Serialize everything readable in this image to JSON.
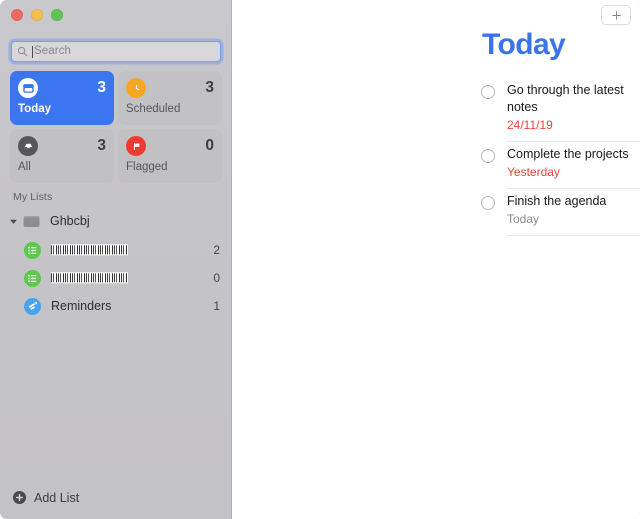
{
  "window": {
    "traffic_lights": [
      {
        "name": "close",
        "color": "#ee6a5e"
      },
      {
        "name": "minimize",
        "color": "#f4bd4f"
      },
      {
        "name": "maximize",
        "color": "#61c454"
      }
    ]
  },
  "sidebar": {
    "search": {
      "placeholder": "Search",
      "value": "",
      "icon": "search-icon"
    },
    "smart_lists": [
      {
        "label": "Today",
        "count": "3",
        "icon": "today-calendar-icon",
        "badge_color": "#ffffff",
        "selected": true
      },
      {
        "label": "Scheduled",
        "count": "3",
        "icon": "clock-icon",
        "badge_color": "#f6a623",
        "selected": false
      },
      {
        "label": "All",
        "count": "3",
        "icon": "inbox-tray-icon",
        "badge_color": "#57575b",
        "selected": false
      },
      {
        "label": "Flagged",
        "count": "0",
        "icon": "flag-icon",
        "badge_color": "#ec3b32",
        "selected": false
      }
    ],
    "section_header": "My Lists",
    "group": {
      "name": "Ghbcbj",
      "expanded": true,
      "icon": "folder-icon",
      "disclosure_icon": "disclosure-triangle-down-icon"
    },
    "lists": [
      {
        "name": "",
        "redacted": true,
        "count": "2",
        "icon": "list-lines-icon",
        "badge_color": "#5cc94a"
      },
      {
        "name": "",
        "redacted": true,
        "count": "0",
        "icon": "list-lines-icon",
        "badge_color": "#5cc94a"
      },
      {
        "name": "Reminders",
        "redacted": false,
        "count": "1",
        "icon": "reminders-app-icon",
        "badge_color": "#4aa3f0"
      }
    ],
    "add_list": {
      "label": "Add List",
      "icon": "plus-circle-icon"
    }
  },
  "content": {
    "add_button": {
      "label": "+",
      "icon": "plus-icon"
    },
    "title": "Today",
    "title_color": "#3b74ea",
    "reminders": [
      {
        "title": "Go through the latest notes",
        "due": "24/11/19",
        "due_state": "overdue",
        "completed": false
      },
      {
        "title": "Complete the projects",
        "due": "Yesterday",
        "due_state": "overdue",
        "completed": false
      },
      {
        "title": "Finish the agenda",
        "due": "Today",
        "due_state": "today",
        "completed": false
      }
    ]
  }
}
